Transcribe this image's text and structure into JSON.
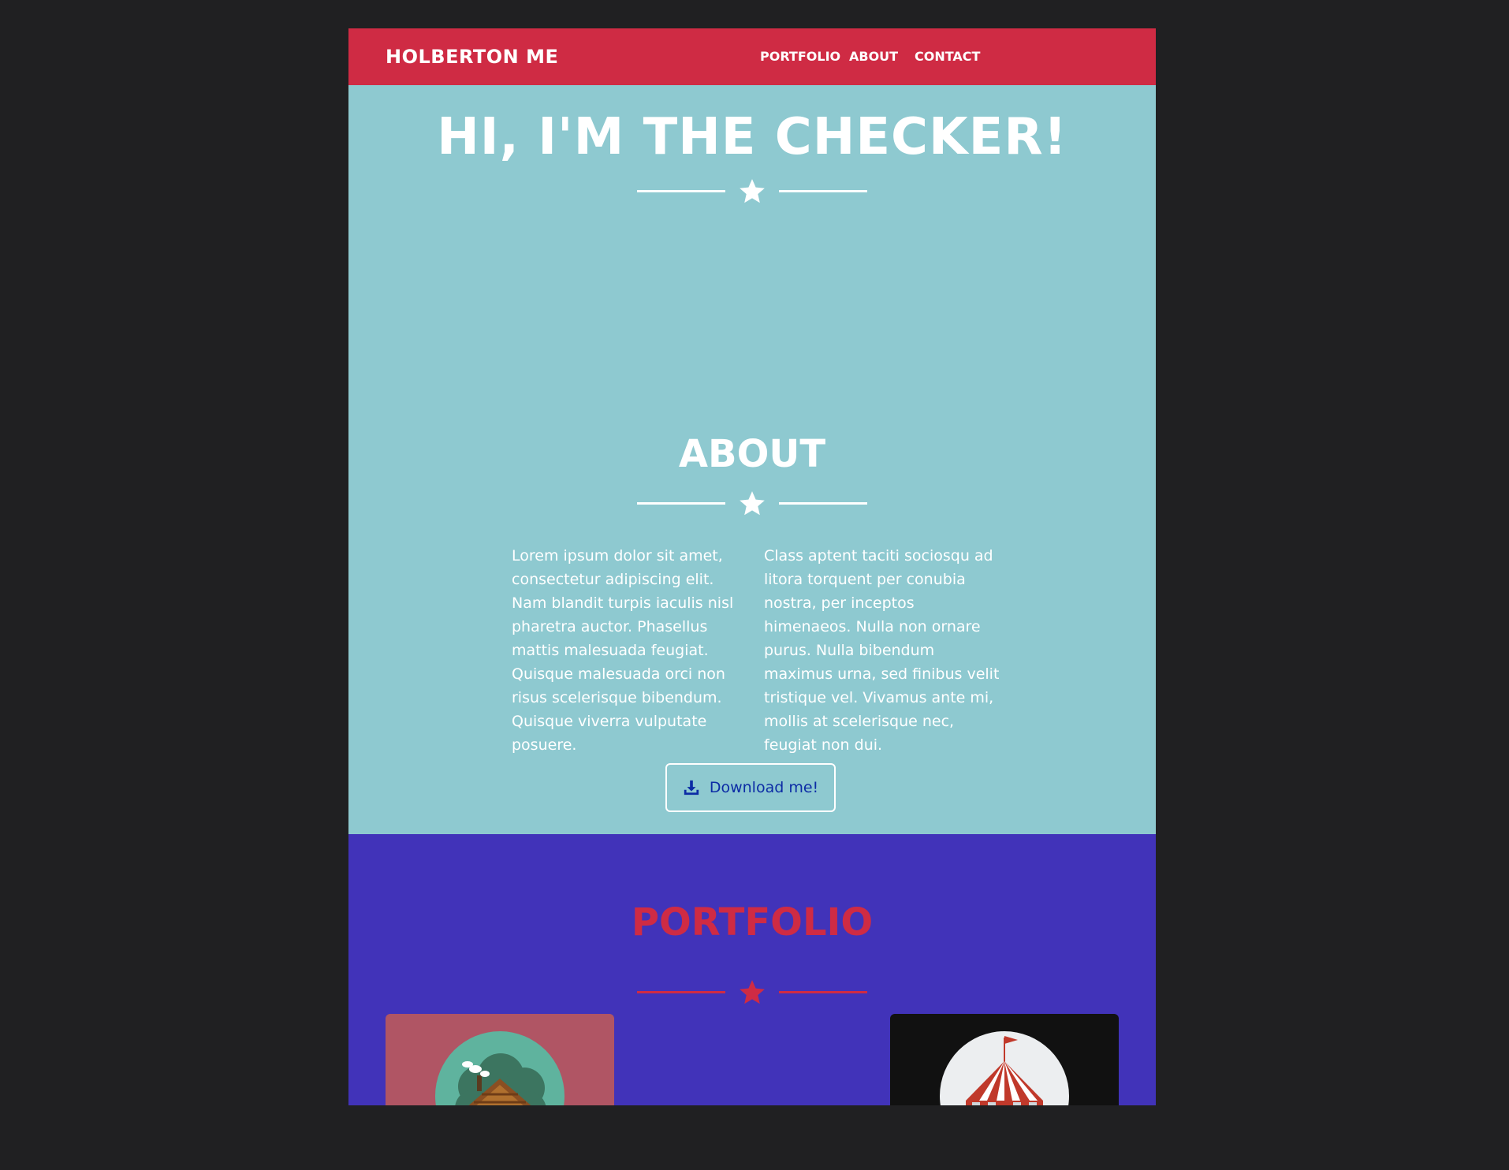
{
  "navbar": {
    "brand": "HOLBERTON ME",
    "links": [
      "PORTFOLIO",
      "ABOUT",
      "CONTACT"
    ]
  },
  "hero": {
    "title": "HI, I'M THE CHECKER!"
  },
  "about": {
    "title": "ABOUT",
    "col1": "Lorem ipsum dolor sit amet, consectetur adipiscing elit. Nam blandit turpis iaculis nisl pharetra auctor. Phasellus mattis malesuada feugiat. Quisque malesuada orci non risus scelerisque bibendum. Quisque viverra vulputate posuere.",
    "col2": "Class aptent taciti sociosqu ad litora torquent per conubia nostra, per inceptos himenaeos. Nulla non ornare purus. Nulla bibendum maximus urna, sed finibus velit tristique vel. Vivamus ante mi, mollis at scelerisque nec, feugiat non dui.",
    "download_label": "Download me!"
  },
  "portfolio": {
    "title": "PORTFOLIO",
    "items": [
      {
        "icon": "cabin-icon"
      },
      {
        "icon": "circus-tent-icon"
      }
    ]
  },
  "colors": {
    "navbar": "#cf2b44",
    "hero_bg": "#8ec9d0",
    "portfolio_bg": "#4133b9",
    "accent_red": "#cf2b44",
    "button_text": "#0c2ca5",
    "page_bg": "#202022"
  }
}
